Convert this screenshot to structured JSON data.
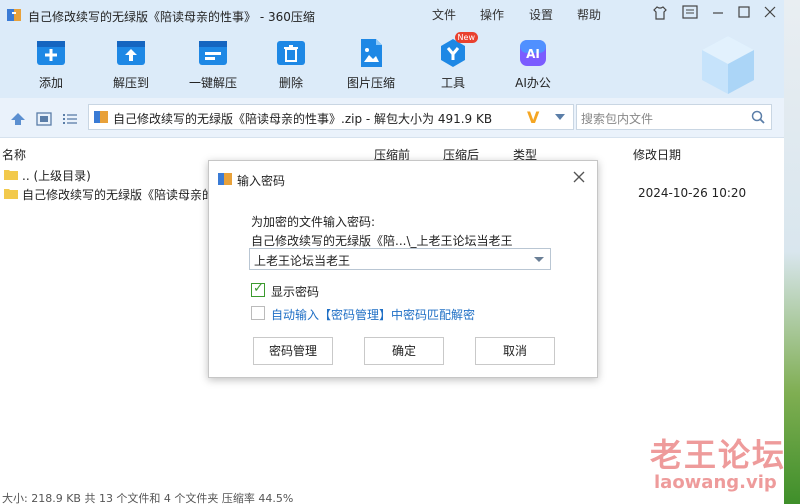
{
  "window": {
    "title": "自己修改续写的无绿版《陪读母亲的性事》 - 360压缩",
    "menu": [
      "文件",
      "操作",
      "设置",
      "帮助"
    ]
  },
  "toolbar": {
    "items": [
      {
        "label": "添加",
        "icon": "add-icon"
      },
      {
        "label": "解压到",
        "icon": "extract-to-icon"
      },
      {
        "label": "一键解压",
        "icon": "one-click-extract-icon"
      },
      {
        "label": "删除",
        "icon": "delete-icon"
      },
      {
        "label": "图片压缩",
        "icon": "image-compress-icon"
      },
      {
        "label": "工具",
        "icon": "tools-icon",
        "badge": "New"
      },
      {
        "label": "AI办公",
        "icon": "ai-office-icon",
        "icon_text": "AI"
      }
    ]
  },
  "address": {
    "path": "自己修改续写的无绿版《陪读母亲的性事》.zip - 解包大小为 491.9 KB",
    "search_placeholder": "搜索包内文件"
  },
  "columns": [
    "名称",
    "压缩前",
    "压缩后",
    "类型",
    "修改日期"
  ],
  "files": [
    {
      "name": ".. (上级目录)",
      "date": ""
    },
    {
      "name": "自己修改续写的无绿版《陪读母亲的性",
      "date": "2024-10-26 10:20"
    }
  ],
  "status": "大小: 218.9 KB 共 13 个文件和 4 个文件夹 压缩率 44.5%",
  "dialog": {
    "title": "输入密码",
    "prompt": "为加密的文件输入密码:",
    "file": "自己修改续写的无绿版《陪...\\_上老王论坛当老王",
    "password": "上老王论坛当老王",
    "show_password": {
      "label": "显示密码",
      "checked": true
    },
    "auto_match": {
      "label": "自动输入【密码管理】中密码匹配解密",
      "checked": false
    },
    "buttons": {
      "manage": "密码管理",
      "ok": "确定",
      "cancel": "取消"
    }
  },
  "watermark": {
    "line1": "老王论坛",
    "line2": "laowang.vip"
  },
  "colors": {
    "accent": "#1e88e5",
    "titlebar": "#dcebf9",
    "link": "#1f6fc5",
    "check": "#3b9a2e"
  }
}
